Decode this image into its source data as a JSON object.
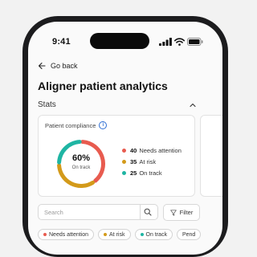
{
  "status_bar": {
    "time": "9:41"
  },
  "nav": {
    "back_label": "Go back"
  },
  "page": {
    "title": "Aligner patient analytics"
  },
  "stats": {
    "label": "Stats",
    "card": {
      "title": "Patient compliance",
      "percent_label": "60%",
      "sub_label": "On track",
      "legend": [
        {
          "count": "40",
          "label": "Needs attention",
          "color": "#e85b4f"
        },
        {
          "count": "35",
          "label": "At risk",
          "color": "#d39a1a"
        },
        {
          "count": "25",
          "label": "On track",
          "color": "#1fb5a3"
        }
      ]
    }
  },
  "chart_data": {
    "type": "pie",
    "categories": [
      "Needs attention",
      "At risk",
      "On track"
    ],
    "values": [
      40,
      35,
      25
    ],
    "colors": [
      "#e85b4f",
      "#d39a1a",
      "#1fb5a3"
    ]
  },
  "search": {
    "placeholder": "Search",
    "value": ""
  },
  "filter": {
    "label": "Filter"
  },
  "chips": [
    {
      "label": "Needs attention",
      "color": "#e85b4f"
    },
    {
      "label": "At risk",
      "color": "#d39a1a"
    },
    {
      "label": "On track",
      "color": "#1fb5a3"
    },
    {
      "label": "Pend",
      "color": ""
    }
  ],
  "colors": {
    "accent": "#2f6fd4"
  }
}
